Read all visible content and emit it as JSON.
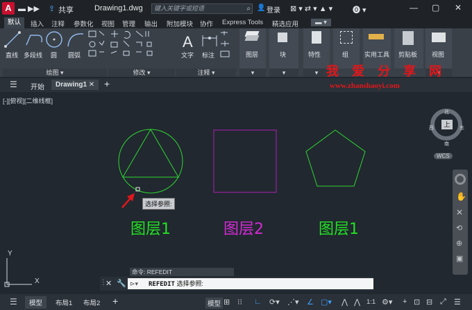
{
  "title_bar": {
    "logo": "A",
    "share": "共享",
    "doc_title": "Drawing1.dwg",
    "search_placeholder": "键入关键字或短语",
    "login": "登录"
  },
  "ribbon_tabs": [
    "默认",
    "插入",
    "注释",
    "参数化",
    "视图",
    "管理",
    "输出",
    "附加模块",
    "协作",
    "Express Tools",
    "精选应用"
  ],
  "draw_tools": {
    "line": "直线",
    "polyline": "多段线",
    "circle": "圆",
    "arc": "圆弧",
    "footer": "绘图"
  },
  "modify_footer": "修改",
  "annotation": {
    "text": "文字",
    "dimension": "标注",
    "footer": "注释"
  },
  "big_tools": {
    "layers": "图层",
    "block": "块",
    "properties": "特性",
    "group": "组",
    "utilities": "实用工具",
    "clipboard": "剪贴板",
    "view": "视图"
  },
  "watermark": {
    "cn": "我 爱 分 享 网",
    "url": "www.zhanshaoyi.com"
  },
  "file_tabs": {
    "start": "开始",
    "drawing": "Drawing1"
  },
  "viewport_label": "[-][俯视][二维线框]",
  "view_cube": {
    "north": "北",
    "south": "南",
    "east": "东",
    "west": "西",
    "top": "上"
  },
  "wcs": "WCS",
  "tooltip": "选择参照:",
  "layer_labels": [
    {
      "text": "图层1",
      "color": "#22e022"
    },
    {
      "text": "图层2",
      "color": "#d42ad4"
    },
    {
      "text": "图层1",
      "color": "#22e022"
    }
  ],
  "shapes": {
    "circle_color": "#2fd82f",
    "square_color": "#b021b0",
    "pentagon_color": "#2fd82f",
    "arrow_color": "#e0171b"
  },
  "ucs": {
    "x": "X",
    "y": "Y"
  },
  "command": {
    "history": "命令: REFEDIT",
    "name": "REFEDIT",
    "prompt": "选择参照:"
  },
  "status_tabs": {
    "model": "模型",
    "layout1": "布局1",
    "layout2": "布局2",
    "model_label": "模型",
    "scale": "1:1"
  }
}
